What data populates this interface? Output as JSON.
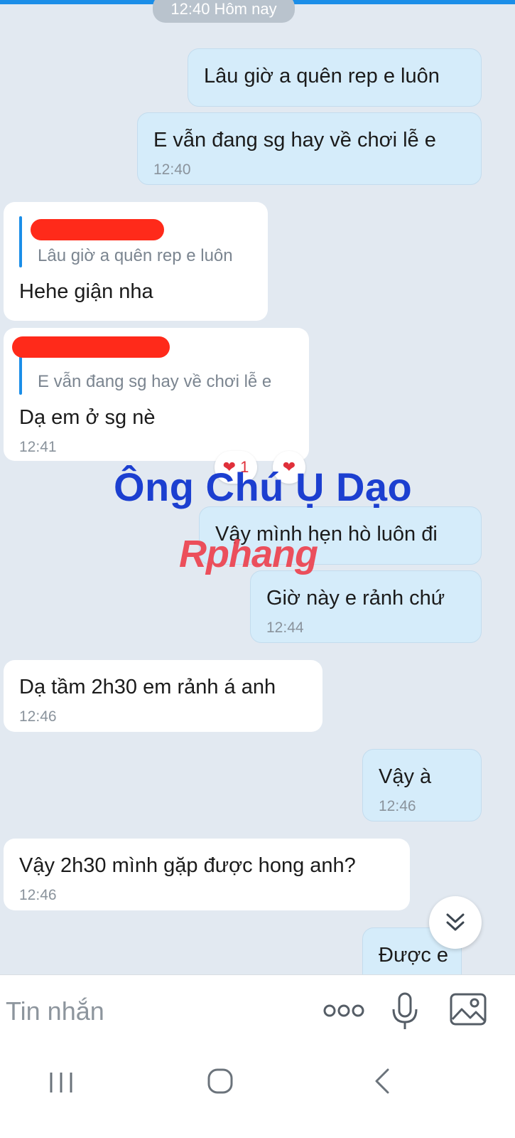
{
  "date_chip": "12:40 Hôm nay",
  "messages": [
    {
      "text": "Lâu giờ a quên rep e luôn",
      "time": ""
    },
    {
      "text": "E vẫn đang sg hay về chơi lễ e",
      "time": "12:40"
    },
    {
      "quote": "Lâu giờ a quên rep e luôn",
      "text": "Hehe giận nha",
      "time": ""
    },
    {
      "quote": "E vẫn đang sg hay về chơi lễ e",
      "text": "Dạ em ở sg nè",
      "time": "12:41"
    },
    {
      "text": "Vậy mình hẹn hò luôn đi",
      "time": ""
    },
    {
      "text": "Giờ này e rảnh chứ",
      "time": "12:44"
    },
    {
      "text": "Dạ tầm 2h30 em rảnh á anh",
      "time": "12:46"
    },
    {
      "text": "Vậy à",
      "time": "12:46"
    },
    {
      "text": "Vậy 2h30 mình gặp được hong anh?",
      "time": "12:46"
    },
    {
      "text": "Được e",
      "time": ""
    }
  ],
  "reactions": [
    "❤ 1",
    "❤"
  ],
  "watermark": {
    "line1": "Ông Chú Ụ Dạo",
    "line2": "Rphang"
  },
  "composer": {
    "placeholder": "Tin nhắn"
  },
  "icons": {
    "more": "more-options-icon",
    "mic": "microphone-icon",
    "image": "image-icon",
    "scroll": "scroll-down-icon",
    "nav_recent": "recent-apps-icon",
    "nav_home": "home-icon",
    "nav_back": "back-icon"
  },
  "colors": {
    "accent": "#1b8ee8",
    "outgoing_bubble": "#d5ecfa",
    "incoming_bubble": "#ffffff",
    "chat_background": "#e2e9f1",
    "redaction": "#ff2a1a"
  }
}
